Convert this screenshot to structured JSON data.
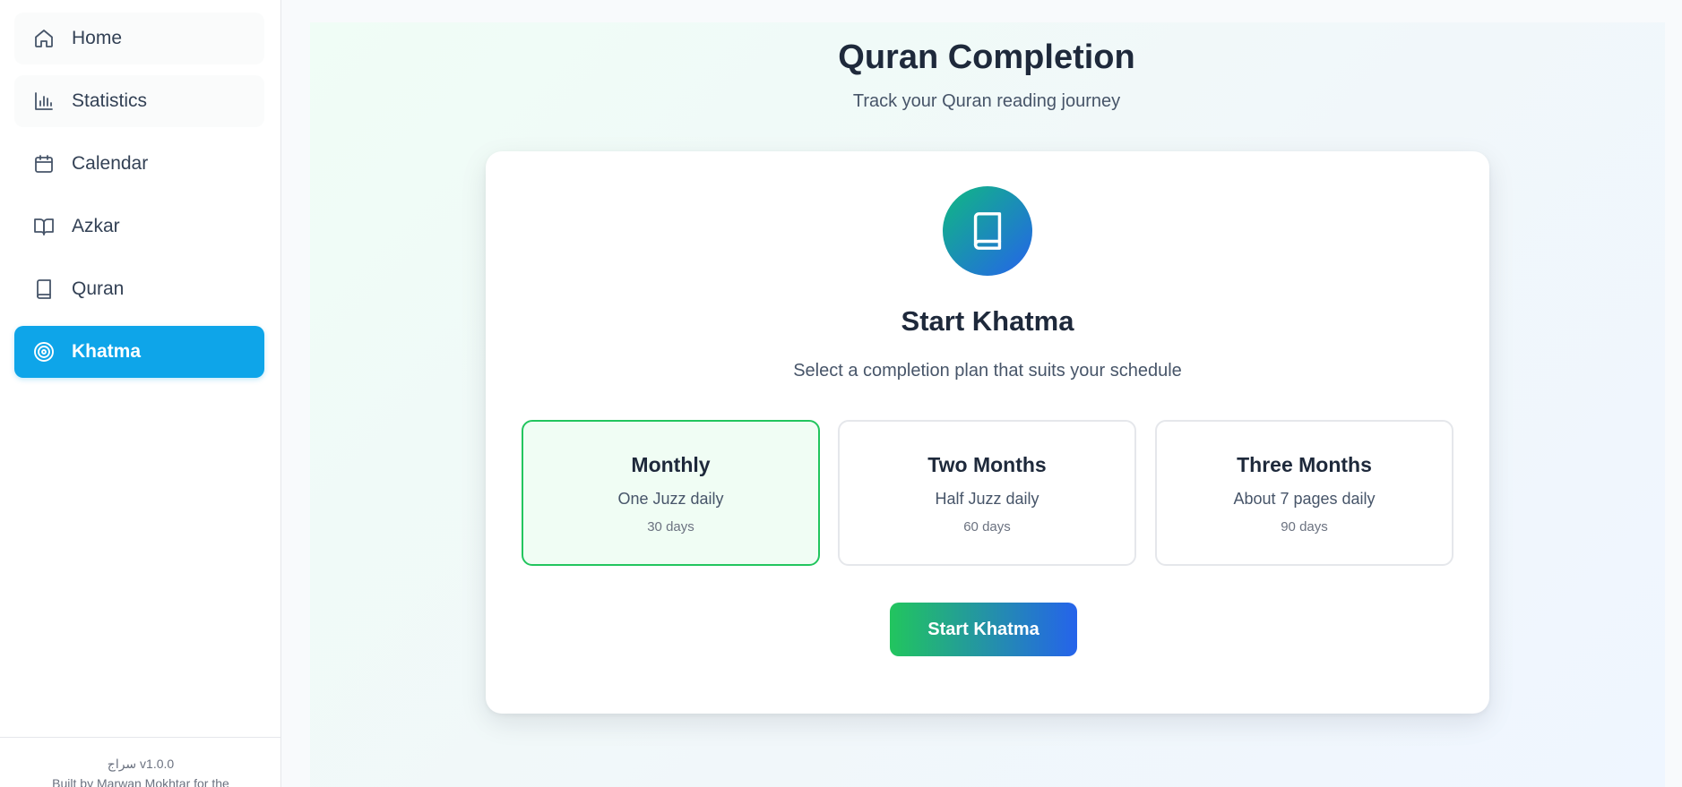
{
  "sidebar": {
    "items": [
      {
        "label": "Home",
        "icon": "home-icon"
      },
      {
        "label": "Statistics",
        "icon": "bar-chart-icon"
      },
      {
        "label": "Calendar",
        "icon": "calendar-icon"
      },
      {
        "label": "Azkar",
        "icon": "open-book-icon"
      },
      {
        "label": "Quran",
        "icon": "book-icon"
      },
      {
        "label": "Khatma",
        "icon": "target-icon",
        "active": true
      }
    ],
    "footer": {
      "version": "سراج v1.0.0",
      "credit": "Built by Marwan Mokhtar for the"
    }
  },
  "main": {
    "title": "Quran Completion",
    "subtitle": "Track your Quran reading journey",
    "card": {
      "icon": "book-icon",
      "title": "Start Khatma",
      "subtitle": "Select a completion plan that suits your schedule",
      "plans": [
        {
          "name": "Monthly",
          "desc": "One Juzz daily",
          "days": "30 days",
          "selected": true
        },
        {
          "name": "Two Months",
          "desc": "Half Juzz daily",
          "days": "60 days",
          "selected": false
        },
        {
          "name": "Three Months",
          "desc": "About 7 pages daily",
          "days": "90 days",
          "selected": false
        }
      ],
      "start_label": "Start Khatma"
    }
  },
  "colors": {
    "active_nav": "#0ea5e9",
    "selected_plan_border": "#22c55e",
    "selected_plan_bg": "#f0fdf4",
    "button_gradient_start": "#22c55e",
    "button_gradient_end": "#2563eb",
    "icon_gradient_start": "#10b981",
    "icon_gradient_end": "#2563eb"
  }
}
